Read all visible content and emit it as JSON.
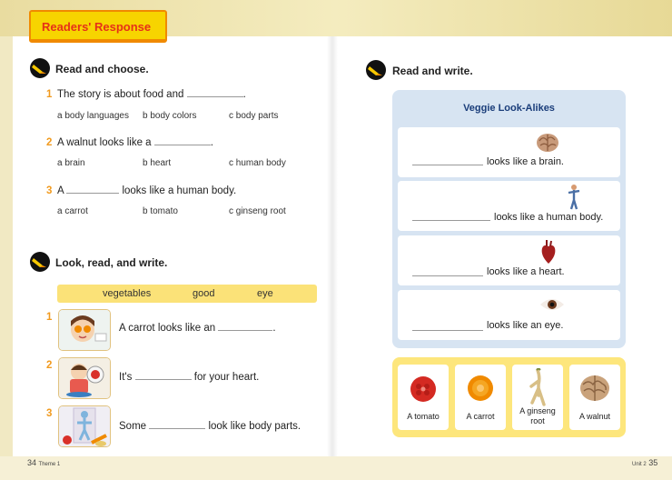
{
  "header": {
    "title": "Readers' Response"
  },
  "left": {
    "section1": {
      "title": "Read and choose.",
      "icon": "pencil-badge-icon",
      "questions": [
        {
          "num": "1",
          "before": "The story is about food and",
          "after": ".",
          "options": [
            "a  body languages",
            "b  body colors",
            "c  body parts"
          ]
        },
        {
          "num": "2",
          "before": "A walnut looks like a",
          "after": ".",
          "options": [
            "a  brain",
            "b  heart",
            "c  human body"
          ]
        },
        {
          "num": "3",
          "before": "A",
          "after": "looks like a human body.",
          "options": [
            "a  carrot",
            "b  tomato",
            "c  ginseng root"
          ]
        }
      ]
    },
    "section2": {
      "title": "Look, read, and write.",
      "icon": "pencil-badge-icon",
      "wordbank": [
        "vegetables",
        "good",
        "eye"
      ],
      "items": [
        {
          "num": "1",
          "before": "A carrot looks like an",
          "after": ".",
          "picture": "girl-with-carrot-eyes-picture"
        },
        {
          "num": "2",
          "before": "It's",
          "after": "for your heart.",
          "picture": "boy-holding-tomato-picture"
        },
        {
          "num": "3",
          "before": "Some",
          "after": "look like body parts.",
          "picture": "ginseng-body-vegetables-picture"
        }
      ]
    },
    "footer": {
      "page": "34",
      "theme": "Theme 1"
    }
  },
  "right": {
    "section": {
      "title": "Read and write.",
      "icon": "pencil-badge-icon"
    },
    "panel_title": "Veggie Look-Alikes",
    "rows": [
      {
        "text": "looks like a brain.",
        "icon": "brain-icon"
      },
      {
        "text": "looks like a human body.",
        "icon": "human-body-icon"
      },
      {
        "text": "looks like a heart.",
        "icon": "heart-organ-icon"
      },
      {
        "text": "looks like an eye.",
        "icon": "eye-icon"
      }
    ],
    "choices": [
      {
        "line1": "A tomato",
        "line2": "",
        "icon": "tomato-icon"
      },
      {
        "line1": "A carrot",
        "line2": "",
        "icon": "carrot-slice-icon"
      },
      {
        "line1": "A ginseng",
        "line2": "root",
        "icon": "ginseng-root-icon"
      },
      {
        "line1": "A walnut",
        "line2": "",
        "icon": "walnut-icon"
      }
    ],
    "footer": {
      "unit": "Unit 2",
      "page": "35"
    }
  },
  "colors": {
    "accent_orange": "#f19a1e",
    "title_red": "#e63118",
    "tab_yellow": "#f7d400",
    "panel_blue": "#d7e4f2",
    "panel_yellow": "#fde67c"
  }
}
